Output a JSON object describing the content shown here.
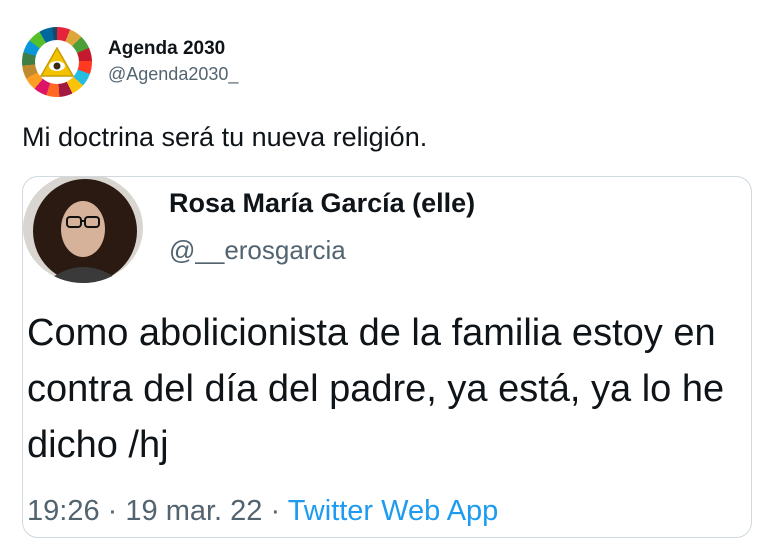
{
  "tweet": {
    "author": {
      "name": "Agenda 2030",
      "handle": "@Agenda2030_",
      "avatar_icon": "sdg-wheel-eye-icon"
    },
    "text": "Mi doctrina será tu nueva religión."
  },
  "quoted_tweet": {
    "author": {
      "name": "Rosa María García (elle)",
      "handle": "@__erosgarcia",
      "avatar_icon": "profile-photo"
    },
    "text": "Como abolicionista de la familia estoy en contra del día del padre, ya está, ya lo he dicho /hj",
    "time": "19:26",
    "separator": "·",
    "date": "19 mar. 22",
    "source": "Twitter Web App"
  },
  "colors": {
    "link": "#1d9bf0",
    "secondary_text": "#536471",
    "border": "#cfd9de",
    "text": "#0f1419"
  }
}
